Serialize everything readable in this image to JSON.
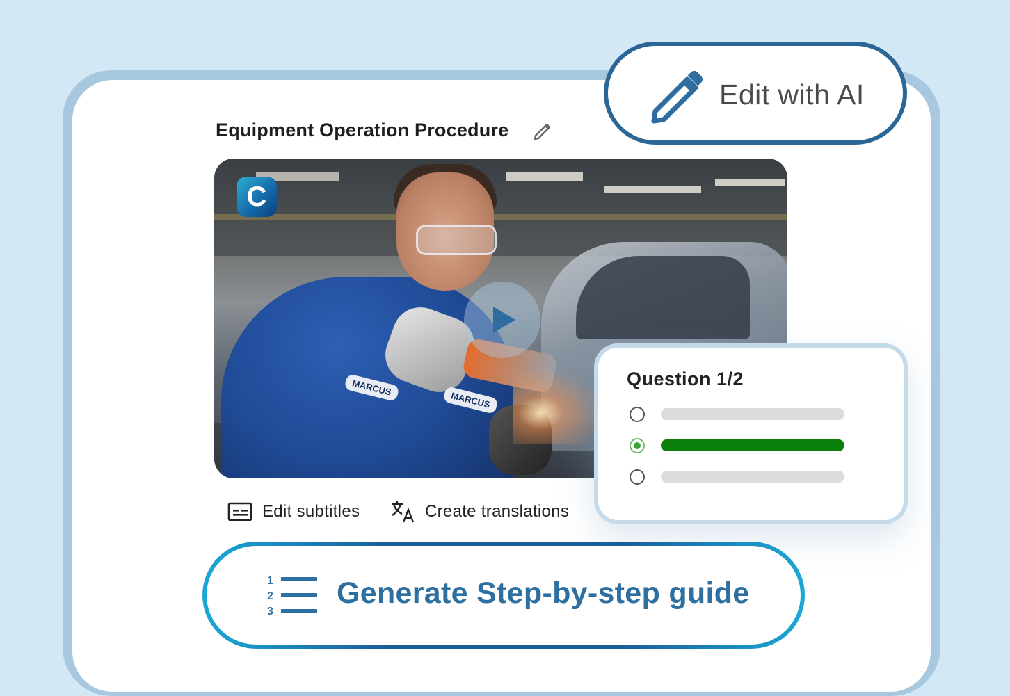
{
  "document": {
    "title": "Equipment Operation Procedure"
  },
  "video": {
    "brand_letter": "C",
    "badge_left": "MARCUS",
    "badge_right": "MARCUS"
  },
  "actions": {
    "edit_ai_label": "Edit with AI",
    "edit_subtitles_label": "Edit  subtitles",
    "create_translations_label": "Create translations",
    "generate_guide_label": "Generate Step-by-step guide"
  },
  "quiz": {
    "title": "Question 1/2",
    "options": [
      {
        "selected": false,
        "correct": false
      },
      {
        "selected": true,
        "correct": true
      },
      {
        "selected": false,
        "correct": false
      }
    ]
  },
  "colors": {
    "page_bg": "#d3e8f5",
    "accent": "#2b6796",
    "guide_text": "#2d6fa0",
    "correct": "#0a7f0a"
  }
}
